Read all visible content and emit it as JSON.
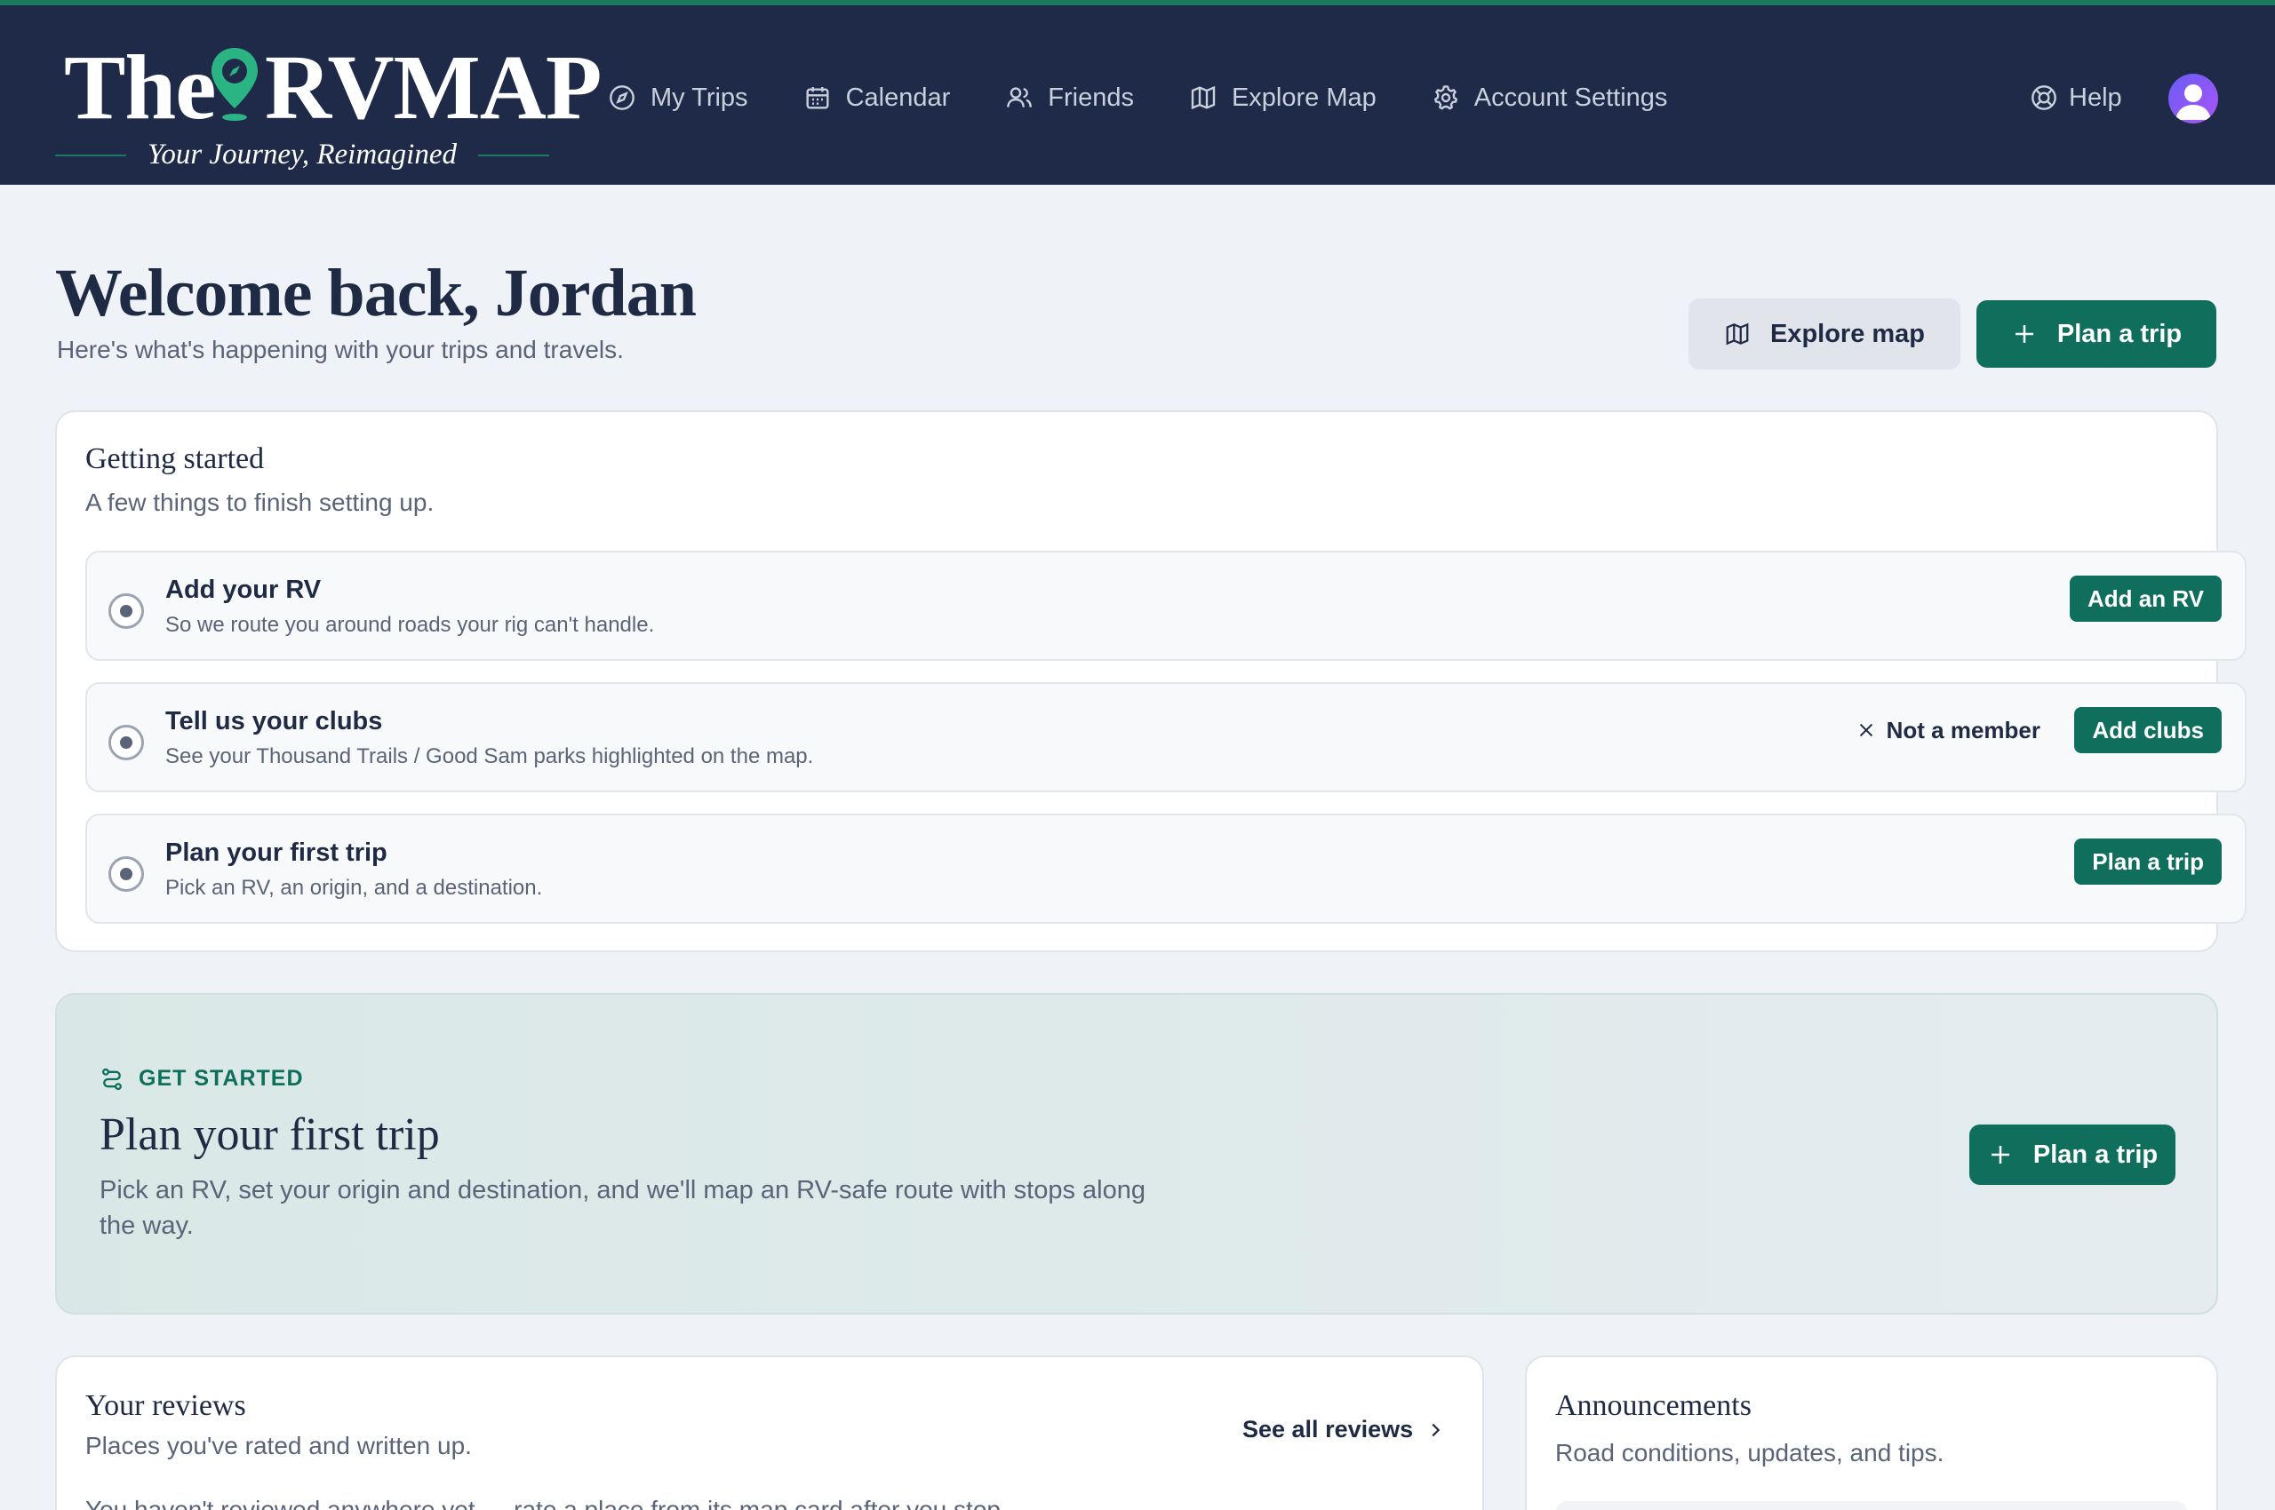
{
  "brand": {
    "word_1": "The",
    "word_2": "RVMAP",
    "tagline": "Your Journey, Reimagined"
  },
  "nav": {
    "items": [
      {
        "label": "My Trips",
        "icon": "compass-icon"
      },
      {
        "label": "Calendar",
        "icon": "calendar-icon"
      },
      {
        "label": "Friends",
        "icon": "users-icon"
      },
      {
        "label": "Explore Map",
        "icon": "map-icon"
      },
      {
        "label": "Account Settings",
        "icon": "gear-icon"
      }
    ],
    "help_label": "Help"
  },
  "header": {
    "title": "Welcome back, Jordan",
    "subtitle": "Here's what's happening with your trips and travels.",
    "explore_label": "Explore map",
    "plan_label": "Plan a trip"
  },
  "getting_started": {
    "title": "Getting started",
    "subtitle": "A few things to finish setting up.",
    "tasks": [
      {
        "title": "Add your RV",
        "desc": "So we route you around roads your rig can't handle.",
        "action": "Add an RV"
      },
      {
        "title": "Tell us your clubs",
        "desc": "See your Thousand Trails / Good Sam parks highlighted on the map.",
        "action": "Add clubs",
        "dismiss": "Not a member"
      },
      {
        "title": "Plan your first trip",
        "desc": "Pick an RV, an origin, and a destination.",
        "action": "Plan a trip"
      }
    ]
  },
  "promo": {
    "eyebrow": "GET STARTED",
    "title": "Plan your first trip",
    "body": "Pick an RV, set your origin and destination, and we'll map an RV-safe route with stops along the way.",
    "button": "Plan a trip"
  },
  "reviews": {
    "title": "Your reviews",
    "subtitle": "Places you've rated and written up.",
    "see_all": "See all reviews",
    "empty": "You haven't reviewed anywhere yet — rate a place from its map card after you stop."
  },
  "announcements": {
    "title": "Announcements",
    "subtitle": "Road conditions, updates, and tips."
  },
  "colors": {
    "nav_bg": "#1e2a48",
    "accent_green": "#0f6f5c",
    "page_bg": "#eff2f6"
  }
}
